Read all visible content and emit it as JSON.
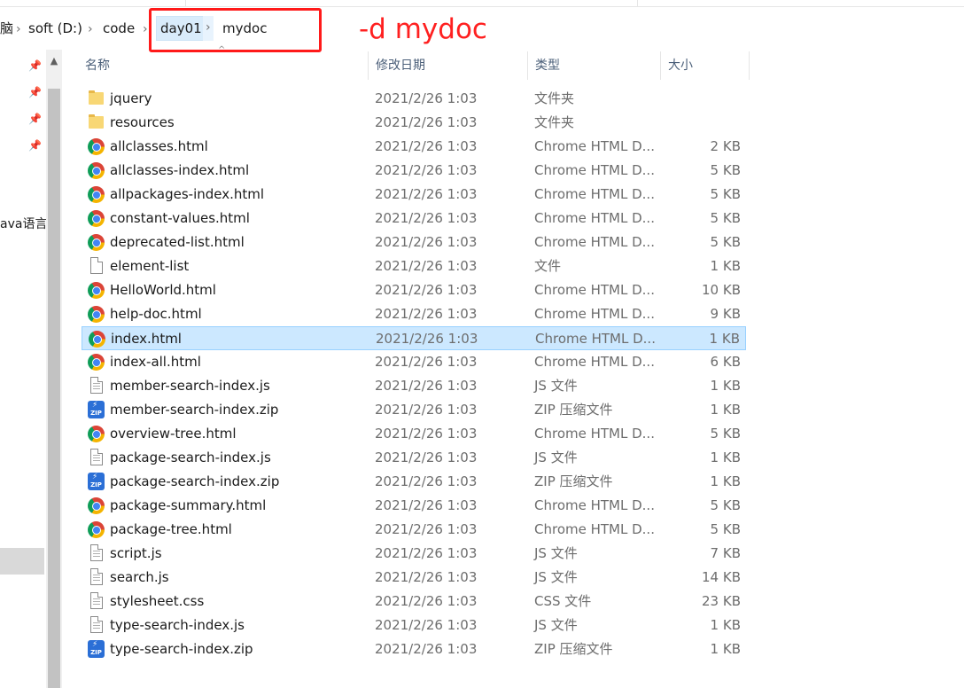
{
  "breadcrumb": {
    "partial": "脑",
    "items": [
      "soft (D:)",
      "code",
      "day01",
      "mydoc"
    ],
    "separator": "›"
  },
  "annotation": {
    "text": "-d mydoc",
    "color": "#ff2020"
  },
  "nav": {
    "partial_text": "ava语言",
    "pin_icon": "pin-icon",
    "scroll_up_icon": "chevron-up-icon"
  },
  "columns": {
    "name": "名称",
    "date": "修改日期",
    "type": "类型",
    "size": "大小"
  },
  "files": [
    {
      "icon": "folder-icon",
      "name": "jquery",
      "date": "2021/2/26 1:03",
      "type": "文件夹",
      "size": ""
    },
    {
      "icon": "folder-icon",
      "name": "resources",
      "date": "2021/2/26 1:03",
      "type": "文件夹",
      "size": ""
    },
    {
      "icon": "chrome-icon",
      "name": "allclasses.html",
      "date": "2021/2/26 1:03",
      "type": "Chrome HTML D...",
      "size": "2 KB"
    },
    {
      "icon": "chrome-icon",
      "name": "allclasses-index.html",
      "date": "2021/2/26 1:03",
      "type": "Chrome HTML D...",
      "size": "5 KB"
    },
    {
      "icon": "chrome-icon",
      "name": "allpackages-index.html",
      "date": "2021/2/26 1:03",
      "type": "Chrome HTML D...",
      "size": "5 KB"
    },
    {
      "icon": "chrome-icon",
      "name": "constant-values.html",
      "date": "2021/2/26 1:03",
      "type": "Chrome HTML D...",
      "size": "5 KB"
    },
    {
      "icon": "chrome-icon",
      "name": "deprecated-list.html",
      "date": "2021/2/26 1:03",
      "type": "Chrome HTML D...",
      "size": "5 KB"
    },
    {
      "icon": "blank-file-icon",
      "name": "element-list",
      "date": "2021/2/26 1:03",
      "type": "文件",
      "size": "1 KB"
    },
    {
      "icon": "chrome-icon",
      "name": "HelloWorld.html",
      "date": "2021/2/26 1:03",
      "type": "Chrome HTML D...",
      "size": "10 KB"
    },
    {
      "icon": "chrome-icon",
      "name": "help-doc.html",
      "date": "2021/2/26 1:03",
      "type": "Chrome HTML D...",
      "size": "9 KB"
    },
    {
      "icon": "chrome-icon",
      "name": "index.html",
      "date": "2021/2/26 1:03",
      "type": "Chrome HTML D...",
      "size": "1 KB",
      "selected": true
    },
    {
      "icon": "chrome-icon",
      "name": "index-all.html",
      "date": "2021/2/26 1:03",
      "type": "Chrome HTML D...",
      "size": "6 KB"
    },
    {
      "icon": "text-file-icon",
      "name": "member-search-index.js",
      "date": "2021/2/26 1:03",
      "type": "JS 文件",
      "size": "1 KB"
    },
    {
      "icon": "zip-icon",
      "name": "member-search-index.zip",
      "date": "2021/2/26 1:03",
      "type": "ZIP 压缩文件",
      "size": "1 KB"
    },
    {
      "icon": "chrome-icon",
      "name": "overview-tree.html",
      "date": "2021/2/26 1:03",
      "type": "Chrome HTML D...",
      "size": "5 KB"
    },
    {
      "icon": "text-file-icon",
      "name": "package-search-index.js",
      "date": "2021/2/26 1:03",
      "type": "JS 文件",
      "size": "1 KB"
    },
    {
      "icon": "zip-icon",
      "name": "package-search-index.zip",
      "date": "2021/2/26 1:03",
      "type": "ZIP 压缩文件",
      "size": "1 KB"
    },
    {
      "icon": "chrome-icon",
      "name": "package-summary.html",
      "date": "2021/2/26 1:03",
      "type": "Chrome HTML D...",
      "size": "5 KB"
    },
    {
      "icon": "chrome-icon",
      "name": "package-tree.html",
      "date": "2021/2/26 1:03",
      "type": "Chrome HTML D...",
      "size": "5 KB"
    },
    {
      "icon": "text-file-icon",
      "name": "script.js",
      "date": "2021/2/26 1:03",
      "type": "JS 文件",
      "size": "7 KB"
    },
    {
      "icon": "text-file-icon",
      "name": "search.js",
      "date": "2021/2/26 1:03",
      "type": "JS 文件",
      "size": "14 KB"
    },
    {
      "icon": "text-file-icon",
      "name": "stylesheet.css",
      "date": "2021/2/26 1:03",
      "type": "CSS 文件",
      "size": "23 KB"
    },
    {
      "icon": "text-file-icon",
      "name": "type-search-index.js",
      "date": "2021/2/26 1:03",
      "type": "JS 文件",
      "size": "1 KB"
    },
    {
      "icon": "zip-icon",
      "name": "type-search-index.zip",
      "date": "2021/2/26 1:03",
      "type": "ZIP 压缩文件",
      "size": "1 KB"
    }
  ],
  "zip_label": "ZIP"
}
